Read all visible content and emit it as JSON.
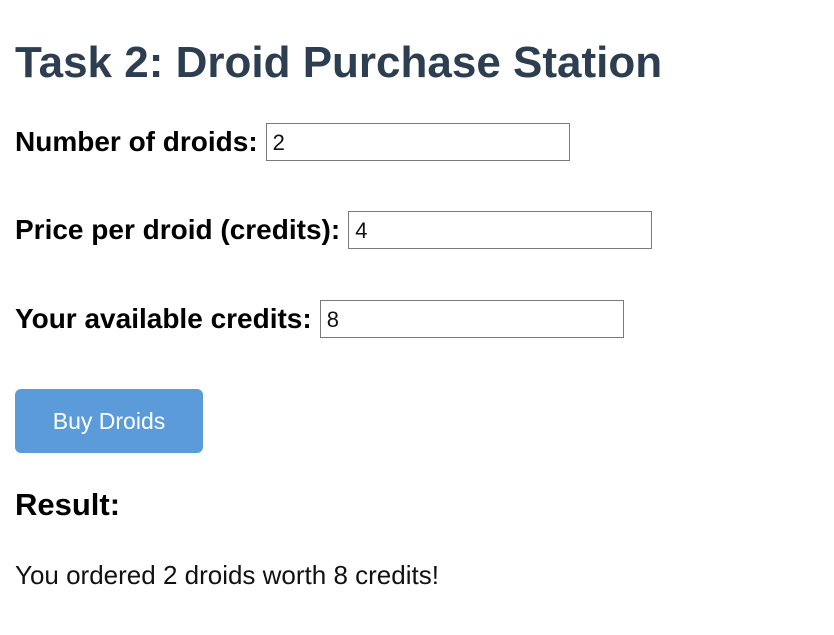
{
  "page": {
    "title": "Task 2: Droid Purchase Station"
  },
  "form": {
    "droid_count": {
      "label": "Number of droids:",
      "value": "2"
    },
    "price_per_droid": {
      "label": "Price per droid (credits):",
      "value": "4"
    },
    "available_credits": {
      "label": "Your available credits:",
      "value": "8"
    },
    "submit_label": "Buy Droids"
  },
  "result": {
    "heading": "Result:",
    "message": "You ordered 2 droids worth 8 credits!"
  },
  "colors": {
    "title": "#2c3e50",
    "button_background": "#5b9bd9",
    "button_text": "#ffffff",
    "input_border": "#7a7a7a"
  }
}
